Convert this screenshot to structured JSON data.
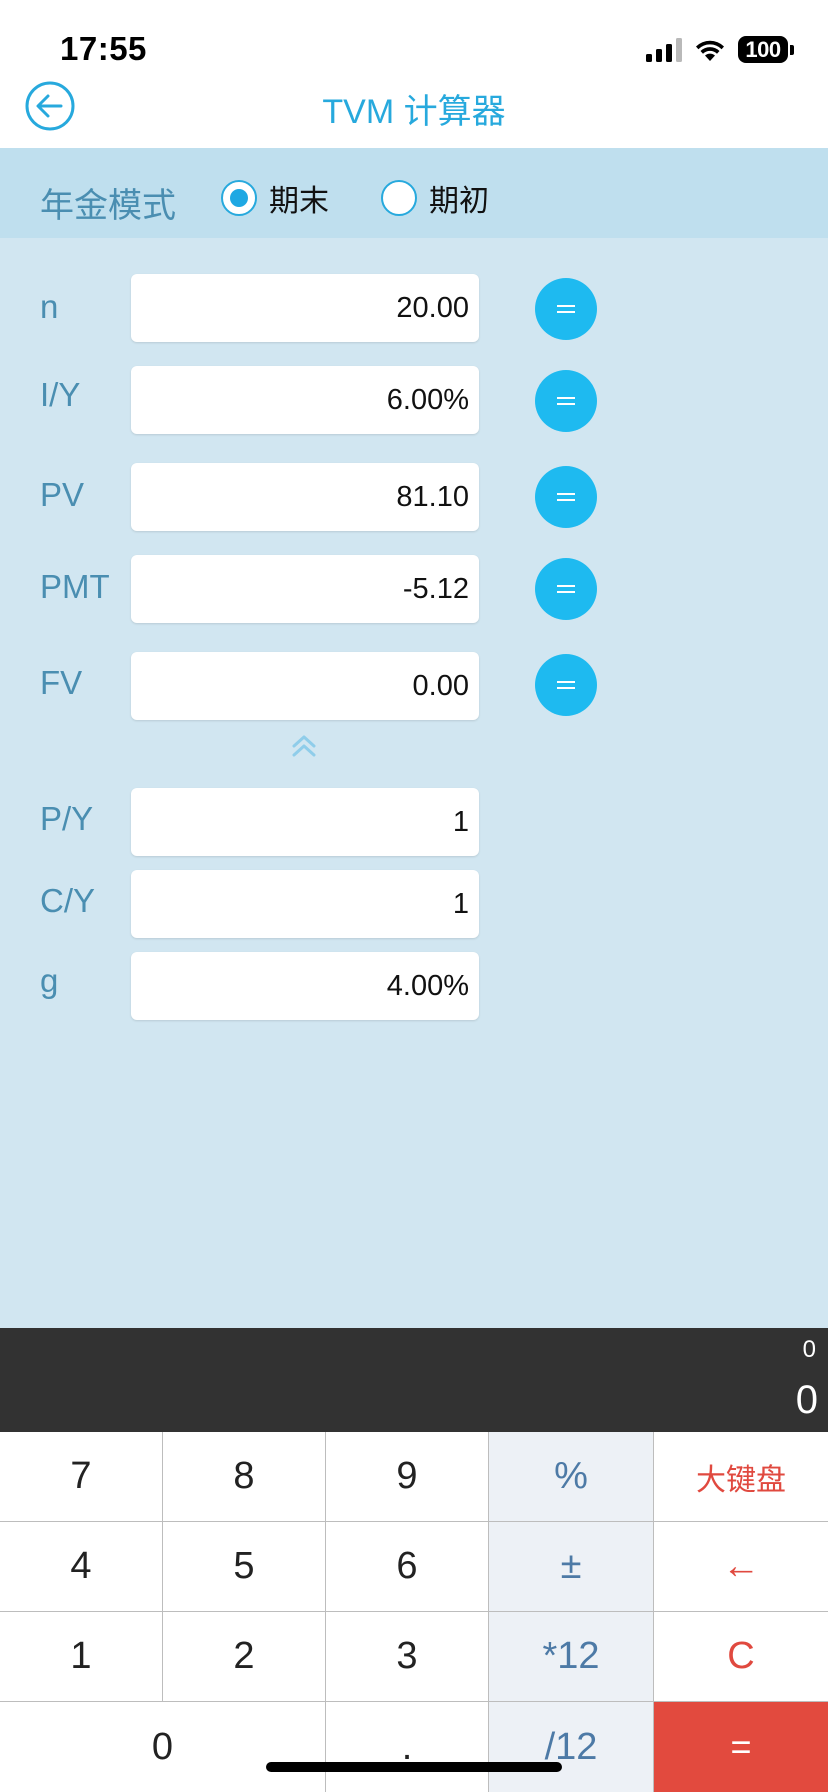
{
  "status_bar": {
    "time": "17:55",
    "battery": "100"
  },
  "nav": {
    "title": "TVM 计算器"
  },
  "mode": {
    "label": "年金模式",
    "options": [
      {
        "label": "期末",
        "selected": true
      },
      {
        "label": "期初",
        "selected": false
      }
    ]
  },
  "fields": {
    "n": {
      "label": "n",
      "value": "20.00"
    },
    "iy": {
      "label": "I/Y",
      "value": "6.00%"
    },
    "pv": {
      "label": "PV",
      "value": "81.10"
    },
    "pmt": {
      "label": "PMT",
      "value": "-5.12"
    },
    "fv": {
      "label": "FV",
      "value": "0.00"
    },
    "py": {
      "label": "P/Y",
      "value": "1"
    },
    "cy": {
      "label": "C/Y",
      "value": "1"
    },
    "g": {
      "label": "g",
      "value": "4.00%"
    }
  },
  "display": {
    "expression": "0",
    "result": "0"
  },
  "keys": {
    "k7": "7",
    "k8": "8",
    "k9": "9",
    "percent": "%",
    "big_keyboard": "大键盘",
    "k4": "4",
    "k5": "5",
    "k6": "6",
    "plus_minus": "±",
    "backspace": "←",
    "k1": "1",
    "k2": "2",
    "k3": "3",
    "times12": "*12",
    "clear": "C",
    "k0": "0",
    "dot": ".",
    "div12": "/12",
    "equals": "="
  },
  "colors": {
    "accent": "#27a9dd",
    "label_text": "#4a8eb1",
    "panel_bg": "#d1e6f1",
    "mode_bar_bg": "#bfdfee",
    "equals_button": "#1ebaf0",
    "display_bg": "#323232",
    "red_key": "#e24a3e"
  }
}
